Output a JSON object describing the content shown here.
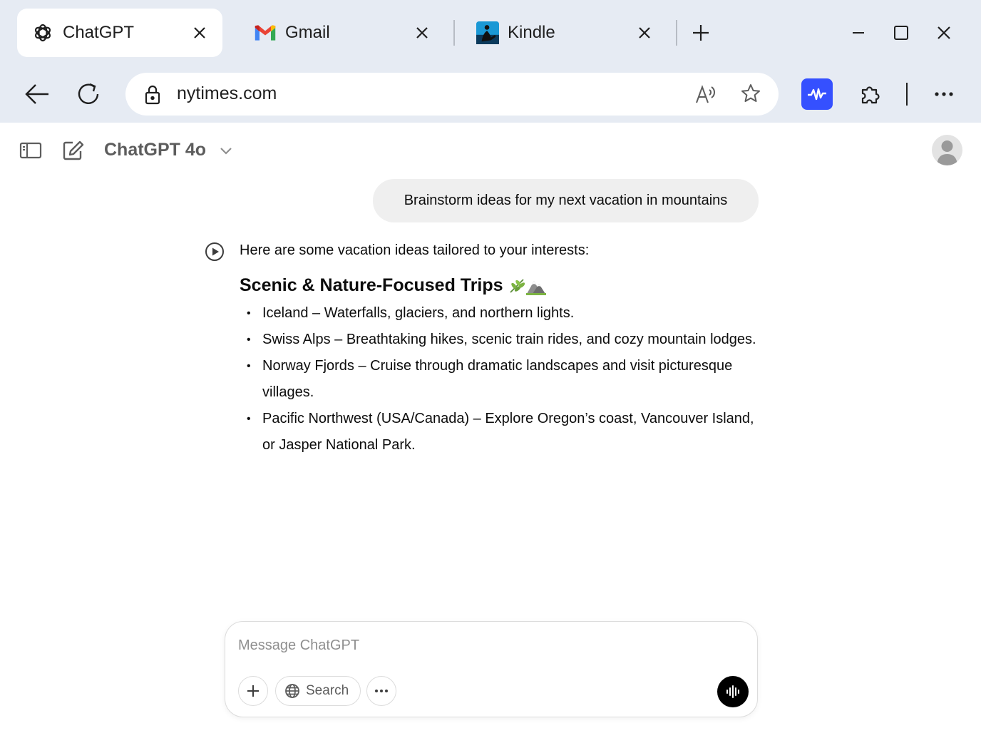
{
  "browser": {
    "tabs": [
      {
        "title": "ChatGPT",
        "icon": "openai-logo-icon",
        "active": true
      },
      {
        "title": "Gmail",
        "icon": "gmail-logo-icon",
        "active": false
      },
      {
        "title": "Kindle",
        "icon": "kindle-logo-icon",
        "active": false
      }
    ],
    "address": {
      "url": "nytimes.com"
    },
    "colors": {
      "chrome_bg": "#e6ebf3",
      "extension_accent": "#3550ff"
    }
  },
  "chat": {
    "model": "ChatGPT 4o",
    "user_message": "Brainstorm ideas for my next vacation in mountains",
    "assistant": {
      "intro": "Here are some vacation ideas tailored to your interests:",
      "heading": "Scenic & Nature-Focused Trips",
      "heading_emoji": [
        "herb-icon",
        "mountain-icon"
      ],
      "items": [
        "Iceland – Waterfalls, glaciers, and northern lights.",
        "Swiss Alps – Breathtaking hikes, scenic train rides, and cozy mountain lodges.",
        "Norway Fjords – Cruise through dramatic landscapes and visit picturesque villages.",
        "Pacific Northwest (USA/Canada) – Explore Oregon’s coast, Vancouver Island, or Jasper National Park."
      ]
    },
    "composer": {
      "placeholder": "Message ChatGPT",
      "value": "",
      "search_label": "Search"
    }
  }
}
